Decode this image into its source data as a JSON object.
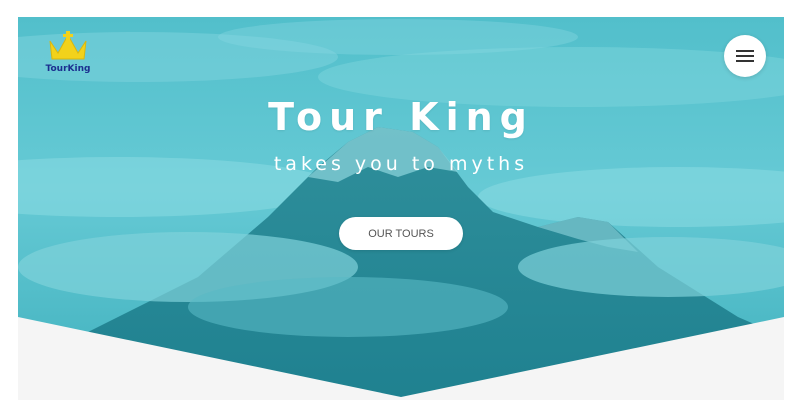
{
  "brand": {
    "logo_text": "TourKing",
    "colors": {
      "crown": "#f2d21b",
      "text": "#1b2f8f"
    }
  },
  "hero": {
    "title": "Tour King",
    "subtitle": "takes you to myths",
    "cta_label": "OUR TOURS",
    "background_color": "#58c3cf",
    "bottom_panel_color": "#f5f5f5"
  },
  "nav": {
    "menu_icon": "hamburger-menu-icon"
  }
}
